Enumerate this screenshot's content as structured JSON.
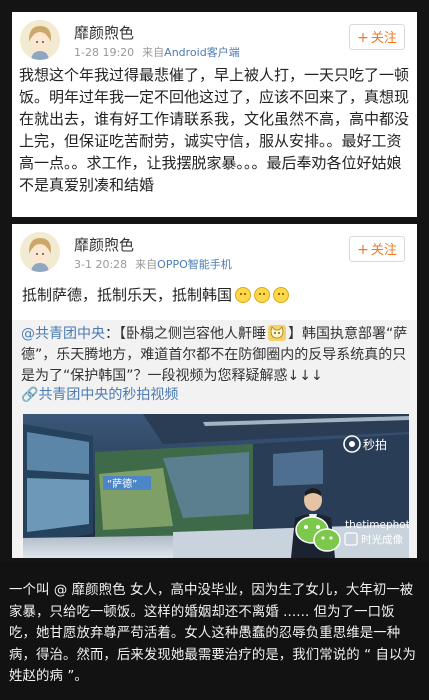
{
  "post1": {
    "username": "靡颜煦色",
    "time": "1-28 19:20",
    "source_prefix": "来自",
    "source": "Android客户端",
    "follow_label": "关注",
    "text": "我想这个年我过得最悲催了，早上被人打，一天只吃了一顿饭。明年过年我一定不回他这过了，应该不回来了，真想现在就出去，谁有好工作请联系我，文化虽然不高，高中都没上完，但保证吃苦耐劳，诚实守信，服从安排。。最好工资高一点。。求工作，让我摆脱家暴。。。最后奉劝各位好姑娘不是真爱别凑和结婚"
  },
  "post2": {
    "username": "靡颜煦色",
    "time": "3-1 20:28",
    "source_prefix": "来自",
    "source": "OPPO智能手机",
    "follow_label": "关注",
    "text": "抵制萨德，抵制乐天，抵制韩国",
    "emoji_count": 3,
    "repost": {
      "author": "@共青团中央",
      "text_before_icon": "：【卧榻之侧岂容他人鼾睡",
      "text_after_icon": "】韩国执意部署“萨德”，乐天腾地方，难道首尔都不在防御圈内的反导系统真的只是为了“保护韩国”？一段视频为您释疑解惑↓↓↓",
      "video_link": "共青团中央的秒拍视频",
      "video": {
        "banner": "“萨德”",
        "watermark_logo": "秒拍",
        "watermark_user": "thetimephoto",
        "watermark_app": "时光成像"
      }
    }
  },
  "caption": "一个叫 @ 靡颜煦色 女人，高中没毕业，因为生了女儿，大年初一被家暴，只给吃一顿饭。这样的婚姻却还不离婚 ...... 但为了一口饭吃，她甘愿放弃尊严苟活着。女人这种愚蠢的忍辱负重思维是一种病，得治。然而，后来发现她最需要治疗的是，我们常说的 “ 自以为姓赵的病 ”。"
}
